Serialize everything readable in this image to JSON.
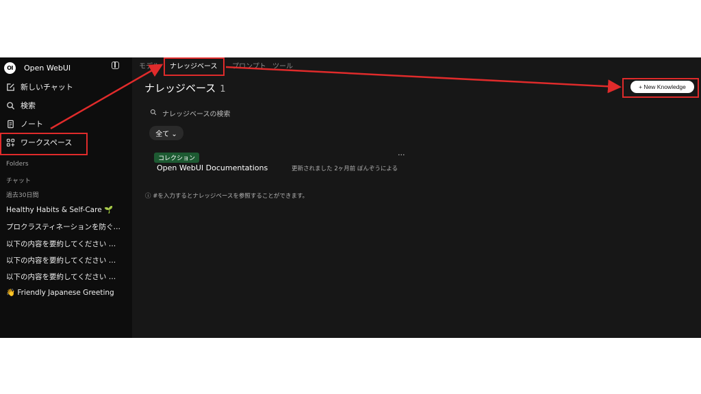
{
  "app": {
    "logo_text": "OI",
    "name": "Open WebUI"
  },
  "sidebar": {
    "nav": [
      {
        "label": "新しいチャット",
        "icon": "edit-icon"
      },
      {
        "label": "検索",
        "icon": "search-icon"
      },
      {
        "label": "ノート",
        "icon": "note-icon"
      },
      {
        "label": "ワークスペース",
        "icon": "workspace-icon"
      }
    ],
    "folders_label": "Folders",
    "chat_label": "チャット",
    "recent_label": "過去30日間",
    "chats": [
      "Healthy Habits & Self-Care 🌱",
      "プロクラスティネーションを防ぐ…",
      "以下の内容を要約してください …",
      "以下の内容を要約してください …",
      "以下の内容を要約してください …",
      "👋 Friendly Japanese Greeting"
    ]
  },
  "tabs": [
    {
      "label": "モデル",
      "active": false
    },
    {
      "label": "ナレッジベース",
      "active": true
    },
    {
      "label": "プロンプト",
      "active": false
    },
    {
      "label": "ツール",
      "active": false
    }
  ],
  "page": {
    "title": "ナレッジベース",
    "count": "1",
    "new_button": "+ New Knowledge",
    "search_placeholder": "ナレッジベースの検索",
    "filter_label": "全て ⌄",
    "hint": "ⓘ #を入力するとナレッジベースを参照することができます。"
  },
  "card": {
    "tag": "コレクション",
    "title": "Open WebUI Documentations",
    "meta": "更新されました 2ヶ月前 ぽんぞうによる",
    "more": "···"
  },
  "colors": {
    "highlight": "#e02b2b",
    "tag_bg": "#1d5a32"
  }
}
